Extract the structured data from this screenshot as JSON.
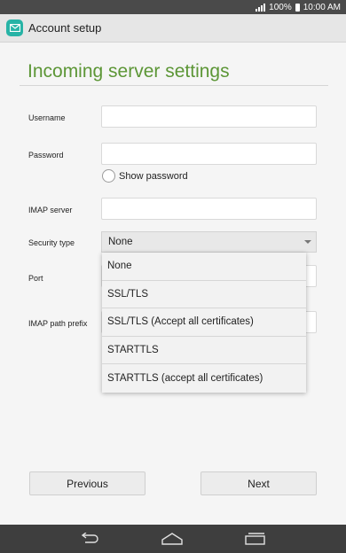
{
  "status_bar": {
    "battery": "100%",
    "time": "10:00 AM"
  },
  "app_bar": {
    "title": "Account setup"
  },
  "page": {
    "heading": "Incoming server settings"
  },
  "form": {
    "username_label": "Username",
    "username_value": "",
    "password_label": "Password",
    "password_value": "",
    "show_password_label": "Show password",
    "imap_server_label": "IMAP server",
    "imap_server_value": "",
    "security_type_label": "Security type",
    "security_type_value": "None",
    "port_label": "Port",
    "imap_path_prefix_label": "IMAP path prefix"
  },
  "dropdown": {
    "options": [
      "None",
      "SSL/TLS",
      "SSL/TLS (Accept all certificates)",
      "STARTTLS",
      "STARTTLS (accept all certificates)"
    ]
  },
  "buttons": {
    "previous": "Previous",
    "next": "Next"
  },
  "icons": {
    "app": "mail-icon",
    "back": "back-icon",
    "home": "home-icon",
    "recents": "recents-icon"
  },
  "colors": {
    "accent": "#5c9636",
    "app_icon": "#27b3a6"
  }
}
